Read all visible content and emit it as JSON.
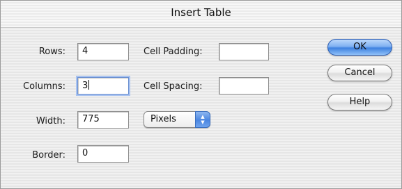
{
  "dialog": {
    "title": "Insert Table"
  },
  "fields": {
    "rows": {
      "label": "Rows:",
      "value": "4"
    },
    "columns": {
      "label": "Columns:",
      "value": "3"
    },
    "width": {
      "label": "Width:",
      "value": "775"
    },
    "border": {
      "label": "Border:",
      "value": "0"
    },
    "cell_padding": {
      "label": "Cell Padding:",
      "value": ""
    },
    "cell_spacing": {
      "label": "Cell Spacing:",
      "value": ""
    }
  },
  "width_unit": {
    "selected": "Pixels",
    "icon": "up-down-arrows-icon"
  },
  "buttons": {
    "ok": "OK",
    "cancel": "Cancel",
    "help": "Help"
  },
  "colors": {
    "default_button": "#4b86e0",
    "focus_ring": "#a9c3f0"
  }
}
